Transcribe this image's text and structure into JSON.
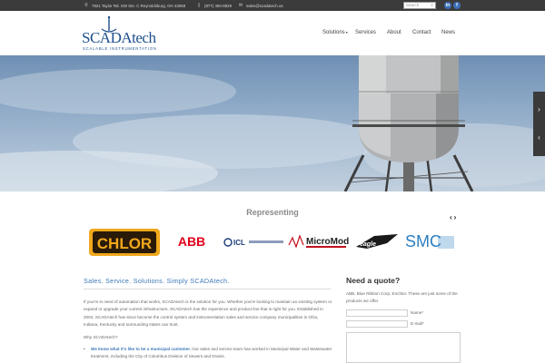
{
  "topbar": {
    "address": "7821 Taylor Rd. SW Ste. C Reynoldsburg, OH 43068",
    "phone": "(877) 460-8829",
    "email": "sales@scadatech.us",
    "search_placeholder": "Search",
    "social": [
      {
        "icon": "linkedin-icon",
        "label": "in"
      },
      {
        "icon": "facebook-icon",
        "label": "f"
      }
    ]
  },
  "logo": {
    "brand": "SCADAtech",
    "subline": "SCALABLE INSTRUMENTATION",
    "color": "#1e4f8c"
  },
  "nav": {
    "items": [
      "Solutions",
      "Services",
      "About",
      "Contact",
      "News"
    ]
  },
  "hero": {
    "slider_arrows": [
      {
        "icon": "chevron-right-icon",
        "glyph": "›"
      },
      {
        "icon": "chevron-left-icon",
        "glyph": "‹"
      }
    ]
  },
  "representing": {
    "title": "Representing",
    "prev": "‹",
    "next": "›",
    "logos": [
      {
        "text": "CHLOR",
        "icon": "enchlor-logo"
      },
      {
        "text": "ABB",
        "icon": "abb-logo"
      },
      {
        "text": "ICL",
        "icon": "icl-logo"
      },
      {
        "text": "MicroMod",
        "icon": "micromod-logo"
      },
      {
        "text": "eagle",
        "icon": "eagle-logo"
      },
      {
        "text": "SMC",
        "icon": "smc-logo"
      }
    ]
  },
  "main": {
    "tagline": "Sales. Service. Solutions. Simply SCADAtech.",
    "paragraph": "If you're in need of automation that works, SCADAtech is the solution for you. Whether you're looking to maintain an existing system or expand or upgrade your current infrastructure, SCADAtech has the experience and product line that is right for you. Established in 2004, SCADAtech has since become the control system and instrumentation sales and service company municipalities in Ohio, Indiana, Kentucky and surrounding states can trust.",
    "why": "Why SCADAtech?",
    "bullet_bold": "We know what it's like to be a municipal customer.",
    "bullet_rest": " Our sales and service team has worked in Municipal Water and Wastewater treatment, including the City of Columbus Division of Sewers and Drains."
  },
  "quote": {
    "title": "Need a quote?",
    "text": "ABB, Blue Ribbon Corp, Enchlor. These are just some of the products we offer.",
    "name_label": "Name*",
    "email_label": "E-mail*"
  },
  "colors": {
    "accent": "#3b78b8",
    "topbar": "#3b3b3b"
  }
}
